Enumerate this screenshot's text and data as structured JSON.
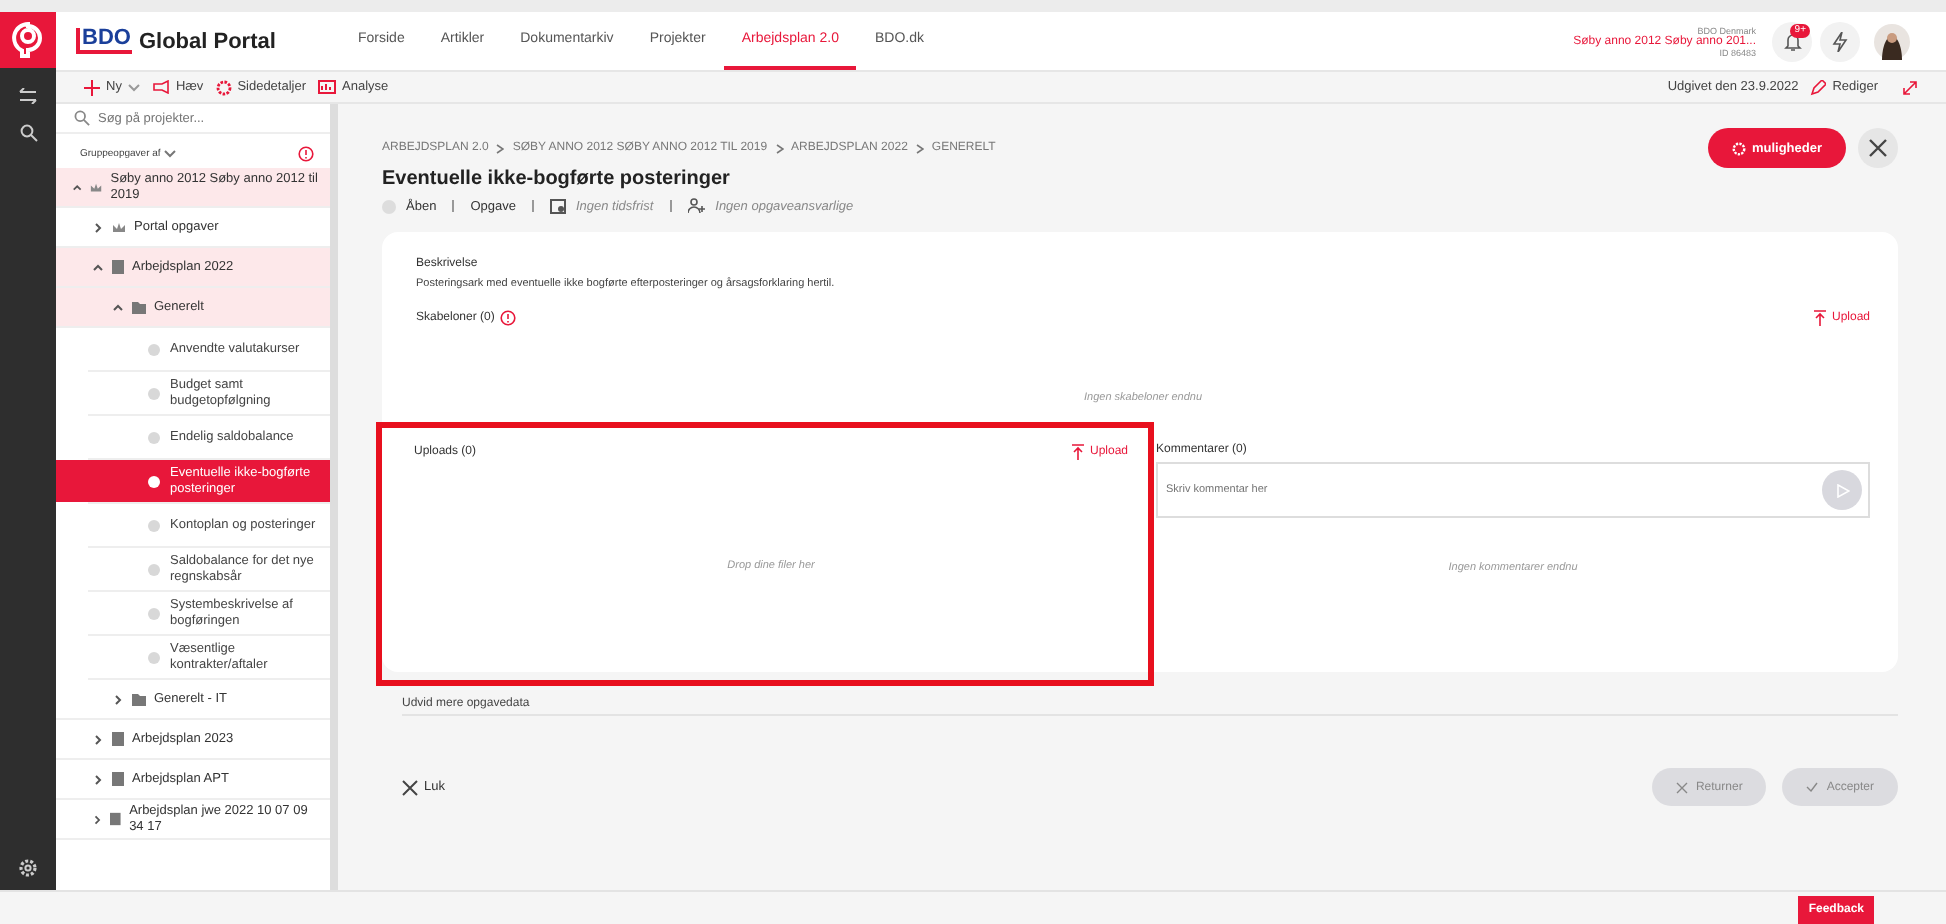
{
  "header": {
    "brand": "BDO",
    "title": "Global Portal",
    "nav": [
      {
        "label": "Forside",
        "selected": false
      },
      {
        "label": "Artikler",
        "selected": false
      },
      {
        "label": "Dokumentarkiv",
        "selected": false
      },
      {
        "label": "Projekter",
        "selected": false
      },
      {
        "label": "Arbejdsplan 2.0",
        "selected": true
      },
      {
        "label": "BDO.dk",
        "selected": false
      }
    ],
    "user": {
      "org": "BDO Denmark",
      "project": "Søby anno 2012 Søby anno 201...",
      "id": "ID 86483"
    },
    "notifications": "9+"
  },
  "toolbar": {
    "actions": [
      "Ny",
      "Hæv",
      "Sidedetaljer",
      "Analyse"
    ],
    "published": "Udgivet den 23.9.2022",
    "edit": "Rediger"
  },
  "sidebar": {
    "search_placeholder": "Søg på projekter...",
    "group_label": "Gruppeopgaver af",
    "tree": [
      {
        "kind": "project",
        "label": "Søby anno 2012 Søby anno 2012 til 2019",
        "expanded": true,
        "children": [
          {
            "kind": "project",
            "label": "Portal opgaver",
            "expanded": false
          },
          {
            "kind": "plan",
            "label": "Arbejdsplan 2022",
            "expanded": true,
            "children": [
              {
                "kind": "folder",
                "label": "Generelt",
                "expanded": true,
                "children": [
                  {
                    "kind": "task",
                    "label": "Anvendte valutakurser",
                    "selected": false
                  },
                  {
                    "kind": "task",
                    "label": "Budget samt budgetopfølgning",
                    "selected": false
                  },
                  {
                    "kind": "task",
                    "label": "Endelig saldobalance",
                    "selected": false
                  },
                  {
                    "kind": "task",
                    "label": "Eventuelle ikke-bogførte posteringer",
                    "selected": true
                  },
                  {
                    "kind": "task",
                    "label": "Kontoplan og posteringer",
                    "selected": false
                  },
                  {
                    "kind": "task",
                    "label": "Saldobalance for det nye regnskabsår",
                    "selected": false
                  },
                  {
                    "kind": "task",
                    "label": "Systembeskrivelse af bogføringen",
                    "selected": false
                  },
                  {
                    "kind": "task",
                    "label": "Væsentlige kontrakter/aftaler",
                    "selected": false
                  }
                ]
              },
              {
                "kind": "folder",
                "label": "Generelt - IT",
                "expanded": false
              }
            ]
          },
          {
            "kind": "plan",
            "label": "Arbejdsplan 2023",
            "expanded": false
          },
          {
            "kind": "plan",
            "label": "Arbejdsplan APT",
            "expanded": false
          },
          {
            "kind": "plan",
            "label": "Arbejdsplan jwe 2022 10 07 09 34 17",
            "expanded": false
          }
        ]
      }
    ]
  },
  "task": {
    "breadcrumb": [
      "ARBEJDSPLAN 2.0",
      "SØBY ANNO 2012 SØBY ANNO 2012 TIL 2019",
      "ARBEJDSPLAN 2022",
      "GENERELT"
    ],
    "options_button": "muligheder",
    "title": "Eventuelle ikke-bogførte posteringer",
    "status": "Åben",
    "type": "Opgave",
    "deadline": "Ingen tidsfrist",
    "responsible": "Ingen opgaveansvarlige",
    "description_label": "Beskrivelse",
    "description": "Posteringsark med eventuelle ikke bogførte efterposteringer og årsagsforklaring hertil.",
    "templates": {
      "label": "Skabeloner (0)",
      "upload": "Upload",
      "empty": "Ingen skabeloner endnu"
    },
    "uploads": {
      "label": "Uploads (0)",
      "upload": "Upload",
      "empty": "Drop dine filer her",
      "highlighted": true
    },
    "comments": {
      "label": "Kommentarer (0)",
      "placeholder": "Skriv kommentar her",
      "empty": "Ingen kommentarer endnu"
    },
    "more": "Udvid mere opgavedata",
    "close": "Luk",
    "return": "Returner",
    "accept": "Accepter"
  },
  "feedback": "Feedback"
}
